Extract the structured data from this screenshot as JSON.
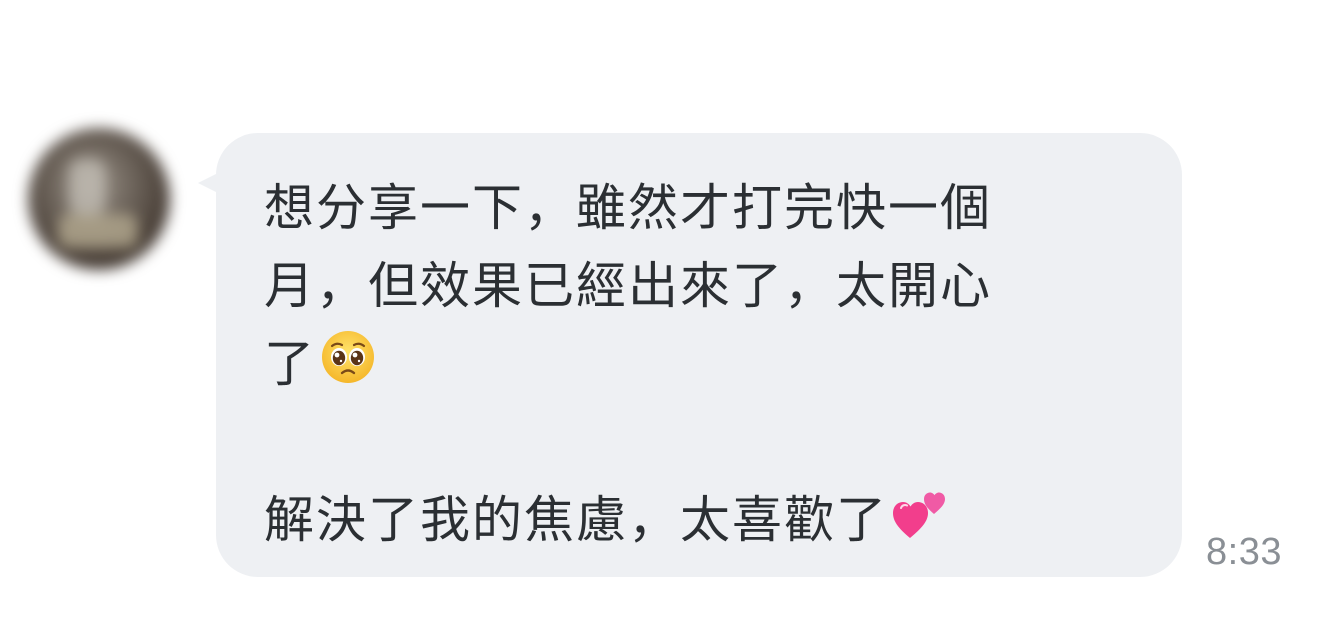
{
  "chat": {
    "message": {
      "lines": [
        "想分享一下，雖然才打完快一個",
        "月，但效果已經出來了，太開心",
        "了",
        "",
        "解決了我的焦慮，太喜歡了"
      ],
      "emojis": [
        "pleading-face-emoji",
        "two-hearts-emoji"
      ],
      "timestamp": "8:33"
    },
    "colors": {
      "bubble": "#eef0f3",
      "text": "#2b2f33",
      "timestamp": "#8a8f95"
    }
  }
}
